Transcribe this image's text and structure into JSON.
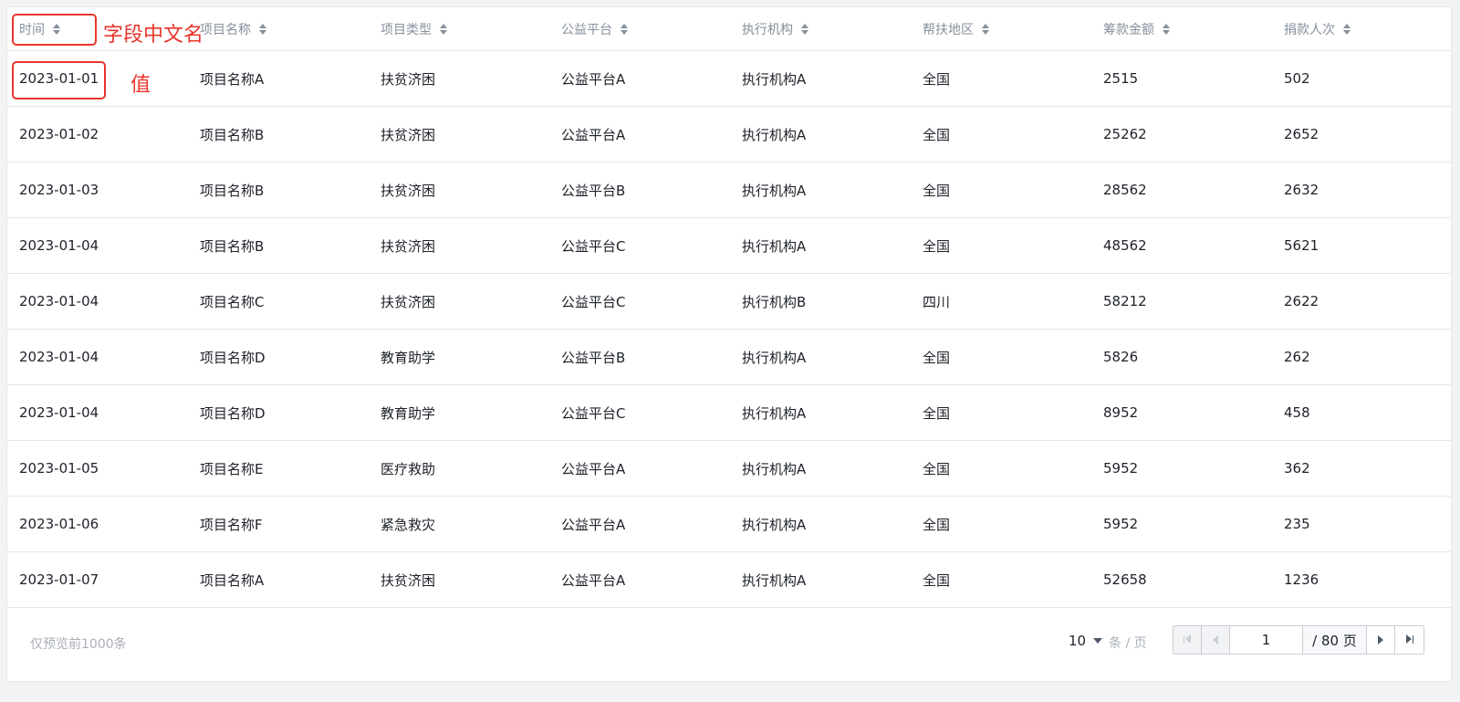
{
  "table": {
    "columns": [
      "时间",
      "项目名称",
      "项目类型",
      "公益平台",
      "执行机构",
      "帮扶地区",
      "筹款金额",
      "捐款人次"
    ],
    "rows": [
      [
        "2023-01-01",
        "项目名称A",
        "扶贫济困",
        "公益平台A",
        "执行机构A",
        "全国",
        "2515",
        "502"
      ],
      [
        "2023-01-02",
        "项目名称B",
        "扶贫济困",
        "公益平台A",
        "执行机构A",
        "全国",
        "25262",
        "2652"
      ],
      [
        "2023-01-03",
        "项目名称B",
        "扶贫济困",
        "公益平台B",
        "执行机构A",
        "全国",
        "28562",
        "2632"
      ],
      [
        "2023-01-04",
        "项目名称B",
        "扶贫济困",
        "公益平台C",
        "执行机构A",
        "全国",
        "48562",
        "5621"
      ],
      [
        "2023-01-04",
        "项目名称C",
        "扶贫济困",
        "公益平台C",
        "执行机构B",
        "四川",
        "58212",
        "2622"
      ],
      [
        "2023-01-04",
        "项目名称D",
        "教育助学",
        "公益平台B",
        "执行机构A",
        "全国",
        "5826",
        "262"
      ],
      [
        "2023-01-04",
        "项目名称D",
        "教育助学",
        "公益平台C",
        "执行机构A",
        "全国",
        "8952",
        "458"
      ],
      [
        "2023-01-05",
        "项目名称E",
        "医疗救助",
        "公益平台A",
        "执行机构A",
        "全国",
        "5952",
        "362"
      ],
      [
        "2023-01-06",
        "项目名称F",
        "紧急救灾",
        "公益平台A",
        "执行机构A",
        "全国",
        "5952",
        "235"
      ],
      [
        "2023-01-07",
        "项目名称A",
        "扶贫济困",
        "公益平台A",
        "执行机构A",
        "全国",
        "52658",
        "1236"
      ]
    ]
  },
  "annotations": {
    "header_label": "字段中文名",
    "value_label": "值",
    "color": "#e8352b"
  },
  "footer": {
    "note": "仅预览前1000条",
    "page_size": "10",
    "page_size_unit": "条 / 页",
    "current_page": "1",
    "total_pages": "/ 80 页"
  },
  "icons": {
    "sort": "sort-icon",
    "first_page": "first-page-icon",
    "prev_page": "prev-page-icon",
    "next_page": "next-page-icon",
    "last_page": "last-page-icon",
    "dropdown": "chevron-down-icon"
  }
}
